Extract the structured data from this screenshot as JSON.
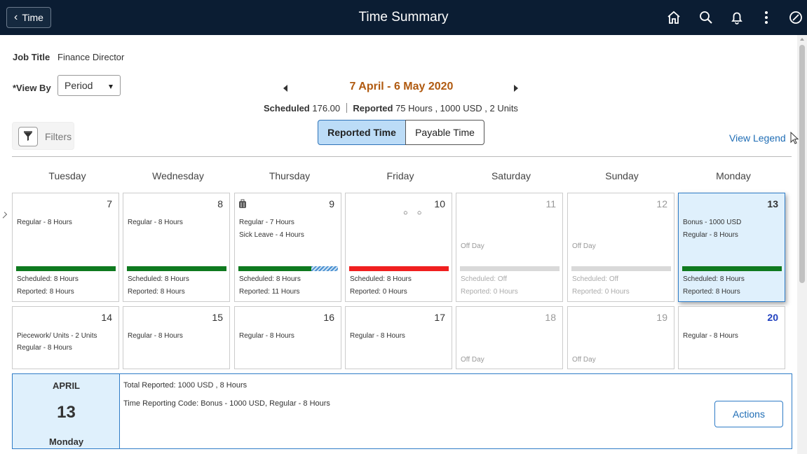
{
  "header": {
    "back_label": "Time",
    "title": "Time Summary",
    "icons": [
      "home-icon",
      "search-icon",
      "bell-icon",
      "more-icon",
      "compass-icon"
    ]
  },
  "job": {
    "label": "Job Title",
    "value": "Finance Director"
  },
  "view_by": {
    "label": "*View By",
    "selected": "Period"
  },
  "period": {
    "title": "7 April - 6 May 2020",
    "scheduled_label": "Scheduled",
    "scheduled_value": "176.00",
    "reported_label": "Reported",
    "reported_value": "75 Hours , 1000 USD , 2 Units"
  },
  "filters_label": "Filters",
  "tabs": {
    "reported": "Reported Time",
    "payable": "Payable Time"
  },
  "view_legend": "View Legend",
  "colors": {
    "accent": "#2f7cc7",
    "ok": "#0f7a1f",
    "missing": "#f01f1f",
    "off": "#d9d9d9",
    "period_title": "#b05a10"
  },
  "weekdays": [
    "Tuesday",
    "Wednesday",
    "Thursday",
    "Friday",
    "Saturday",
    "Sunday",
    "Monday"
  ],
  "week1": [
    {
      "date": "7",
      "l1": "Regular - 8 Hours",
      "l2": "",
      "sched": "Scheduled: 8 Hours",
      "rep": "Reported: 8 Hours"
    },
    {
      "date": "8",
      "l1": "Regular - 8 Hours",
      "l2": "",
      "sched": "Scheduled: 8 Hours",
      "rep": "Reported: 8 Hours"
    },
    {
      "date": "9",
      "l1": "Regular - 7 Hours",
      "l2": "Sick Leave - 4 Hours",
      "sched": "Scheduled: 8 Hours",
      "rep": "Reported: 11 Hours"
    },
    {
      "date": "10",
      "l1": "",
      "l2": "",
      "sched": "Scheduled: 8 Hours",
      "rep": "Reported: 0 Hours",
      "marks": "○ ○"
    },
    {
      "date": "11",
      "off": "Off Day",
      "sched": "Scheduled: Off",
      "rep": "Reported: 0 Hours"
    },
    {
      "date": "12",
      "off": "Off Day",
      "sched": "Scheduled: Off",
      "rep": "Reported: 0 Hours"
    },
    {
      "date": "13",
      "l1": "Bonus - 1000 USD",
      "l2": "Regular - 8 Hours",
      "sched": "Scheduled: 8 Hours",
      "rep": "Reported: 8 Hours"
    }
  ],
  "week2": [
    {
      "date": "14",
      "l1": "Piecework/ Units - 2 Units",
      "l2": "Regular - 8 Hours"
    },
    {
      "date": "15",
      "l1": "Regular - 8 Hours"
    },
    {
      "date": "16",
      "l1": "Regular - 8 Hours"
    },
    {
      "date": "17",
      "l1": "Regular - 8 Hours"
    },
    {
      "date": "18",
      "off": "Off Day"
    },
    {
      "date": "19",
      "off": "Off Day"
    },
    {
      "date": "20",
      "l1": "Regular - 8 Hours"
    }
  ],
  "detail": {
    "month": "APRIL",
    "day": "13",
    "weekday": "Monday",
    "total_label": "Total Reported:",
    "total_value": "1000 USD , 8 Hours",
    "trc_label": "Time Reporting Code:",
    "trc_value": "Bonus - 1000 USD, Regular - 8 Hours",
    "actions_label": "Actions"
  }
}
